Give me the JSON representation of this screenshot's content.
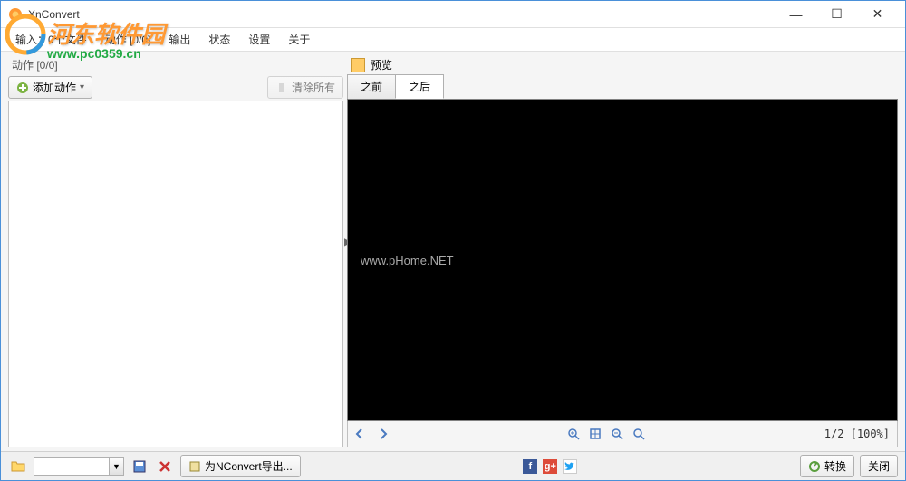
{
  "window": {
    "title": "XnConvert",
    "minimize": "—",
    "maximize": "☐",
    "close": "✕"
  },
  "menubar": {
    "items": [
      "输入：0个文件",
      "动作 [0/0]",
      "输出",
      "状态",
      "设置",
      "关于"
    ]
  },
  "left": {
    "header": "动作 [0/0]",
    "add_action": "添加动作",
    "clear_all": "清除所有"
  },
  "right": {
    "preview_label": "预览",
    "tabs": {
      "before": "之前",
      "after": "之后"
    },
    "zoom_info": "1/2 [100%]",
    "watermark": "www.pHome.NET"
  },
  "bottom": {
    "export_label": "为NConvert导出...",
    "convert": "转换",
    "close": "关闭"
  },
  "watermark": {
    "line1": "河东软件园",
    "line2": "www.pc0359.cn"
  }
}
